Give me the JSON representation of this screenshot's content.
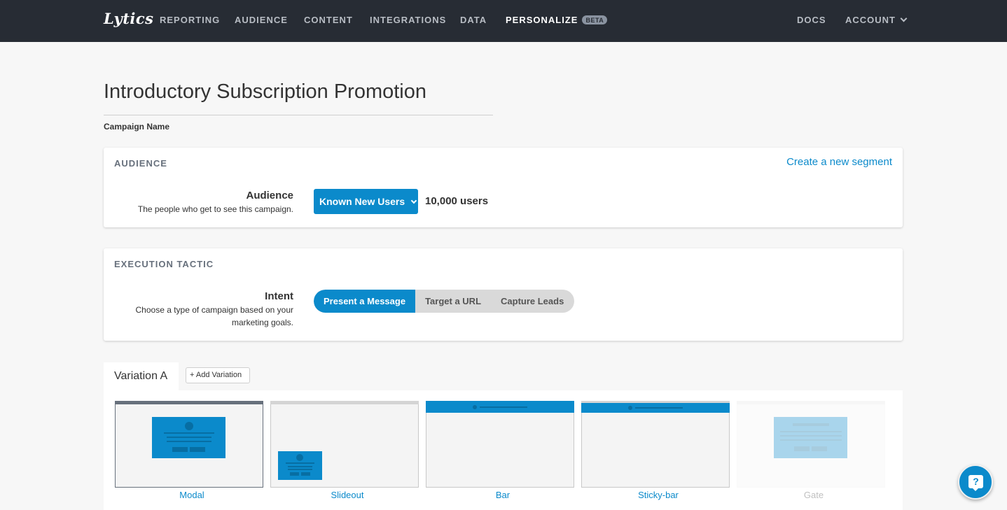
{
  "nav": {
    "logo": "Lytics",
    "items": [
      "REPORTING",
      "AUDIENCE",
      "CONTENT",
      "INTEGRATIONS",
      "DATA",
      "PERSONALIZE"
    ],
    "beta_badge": "BETA",
    "right_items": [
      "DOCS",
      "ACCOUNT"
    ]
  },
  "campaign": {
    "name": "Introductory Subscription Promotion",
    "name_label": "Campaign Name"
  },
  "audience_card": {
    "heading": "AUDIENCE",
    "create_link": "Create a new segment",
    "label": "Audience",
    "description": "The people who get to see this campaign.",
    "selected_segment": "Known New Users",
    "user_count": "10,000 users"
  },
  "tactic_card": {
    "heading": "EXECUTION TACTIC",
    "label": "Intent",
    "description_line1": "Choose a type of campaign based on your",
    "description_line2": "marketing goals.",
    "options": [
      "Present a Message",
      "Target a URL",
      "Capture Leads"
    ],
    "selected_option": "Present a Message"
  },
  "variations": {
    "active_tab": "Variation A",
    "add_label": "+ Add Variation",
    "layouts": [
      "Modal",
      "Slideout",
      "Bar",
      "Sticky-bar",
      "Gate"
    ],
    "selected_layout": "Modal",
    "disabled_layout": "Gate"
  },
  "colors": {
    "nav_bg": "#272c34",
    "accent": "#0b8acb",
    "page_bg": "#f7f7f7"
  },
  "help_button": {
    "icon": "question-bubble-icon",
    "glyph": "?"
  }
}
